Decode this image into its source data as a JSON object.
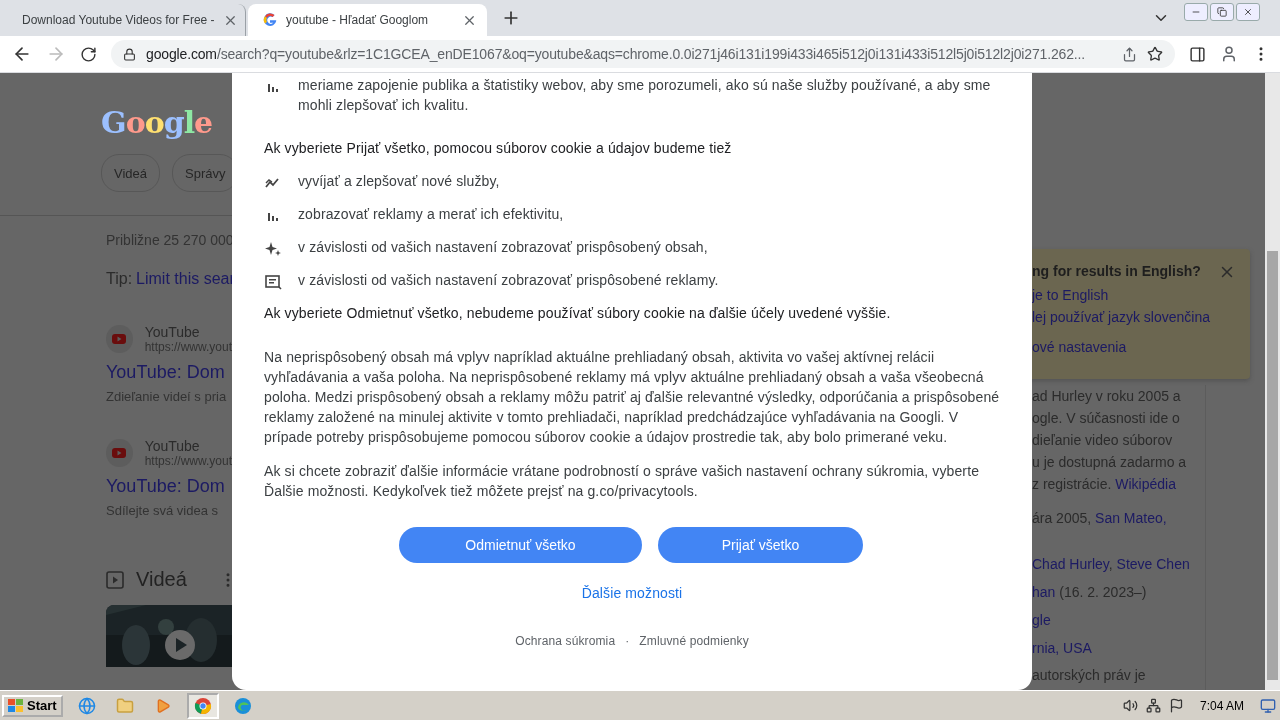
{
  "browser": {
    "tabs": [
      {
        "title": "Download Youtube Videos for Free -",
        "selected": false
      },
      {
        "title": "youtube - Hľadať Googlom",
        "selected": true
      }
    ],
    "address": {
      "host": "google.com",
      "path": "/search?q=youtube&rlz=1C1GCEA_enDE1067&oq=youtube&aqs=chrome.0.0i271j46i131i199i433i465i512j0i131i433i512l5j0i512l2j0i271.262..."
    }
  },
  "page_left": {
    "logo": "Google",
    "chips": [
      "Videá",
      "Správy"
    ],
    "result_count": "Približne 25 270 000",
    "tip_label": "Tip:",
    "tip_link": "Limit this sear",
    "results": [
      {
        "site": "YouTube",
        "url": "https://www.yout",
        "title": "YouTube: Dom",
        "snippet": "Zdieľanie videí s pria"
      },
      {
        "site": "YouTube",
        "url": "https://www.yout",
        "title": "YouTube: Dom",
        "snippet": "Sdílejte svá videa s"
      }
    ],
    "videos_heading": "Videá"
  },
  "page_right": {
    "language_prompt": {
      "title": "ng for results in English?",
      "links": [
        "je to English",
        "lej používať jazyk slovenčina",
        "ové nastavenia"
      ]
    },
    "knowledge_lines": [
      [
        {
          "text": "ad Hurley v roku 2005 a",
          "link": false
        }
      ],
      [
        {
          "text": "ogle. V súčasnosti ide o",
          "link": false
        }
      ],
      [
        {
          "text": "dieľanie video súborov",
          "link": false
        }
      ],
      [
        {
          "text": "u je dostupná zadarmo a",
          "link": false
        }
      ],
      [
        {
          "text": "z registrácie. ",
          "link": false
        },
        {
          "text": "Wikipédia",
          "link": true
        }
      ],
      [
        {
          "text": "ára 2005, ",
          "link": false
        },
        {
          "text": "San Mateo,",
          "link": true
        }
      ],
      [
        {
          "text": "Chad Hurley",
          "link": true
        },
        {
          "text": ", ",
          "link": false
        },
        {
          "text": "Steve Chen",
          "link": true
        }
      ],
      [
        {
          "text": "han",
          "link": true
        },
        {
          "text": " (16. 2. 2023–)",
          "link": false
        }
      ],
      [
        {
          "text": "gle",
          "link": true
        }
      ],
      [
        {
          "text": "rnia, USA",
          "link": true
        }
      ],
      [
        {
          "text": "autorských práv je",
          "link": false
        }
      ]
    ]
  },
  "dialog": {
    "top_items": [
      {
        "kind": "bars",
        "text": "meriame zapojenie publika a štatistiky webov, aby sme porozumeli, ako sú naše služby používané, a aby sme mohli zlepšovať ich kvalitu."
      }
    ],
    "accept_intro": "Ak vyberiete Prijať všetko, pomocou súborov cookie a údajov budeme tiež",
    "accept_items": [
      {
        "kind": "trend",
        "text": "vyvíjať a zlepšovať nové služby,"
      },
      {
        "kind": "bars",
        "text": "zobrazovať reklamy a merať ich efektivitu,"
      },
      {
        "kind": "sparkle",
        "text": "v závislosti od vašich nastavení zobrazovať prispôsobený obsah,"
      },
      {
        "kind": "ad",
        "text": "v závislosti od vašich nastavení zobrazovať prispôsobené reklamy."
      }
    ],
    "decline_text": "Ak vyberiete Odmietnuť všetko, nebudeme používať súbory cookie na ďalšie účely uvedené vyššie.",
    "paragraphs": [
      "Na neprispôsobený obsah má vplyv napríklad aktuálne prehliadaný obsah, aktivita vo vašej aktívnej relácii vyhľadávania a vaša poloha. Na neprispôsobené reklamy má vplyv aktuálne prehliadaný obsah a vaša všeobecná poloha. Medzi prispôsobený obsah a reklamy môžu patriť aj ďalšie relevantné výsledky, odporúčania a prispôsobené reklamy založené na minulej aktivite v tomto prehliadači, napríklad predchádzajúce vyhľadávania na Googli. V prípade potreby prispôsobujeme pomocou súborov cookie a údajov prostredie tak, aby bolo primerané veku.",
      "Ak si chcete zobraziť ďalšie informácie vrátane podrobností o správe vašich nastavení ochrany súkromia, vyberte Ďalšie možnosti. Kedykoľvek tiež môžete prejsť na g.co/privacytools."
    ],
    "buttons": [
      "Odmietnuť všetko",
      "Prijať všetko"
    ],
    "more_link": "Ďalšie možnosti",
    "footer_links": [
      "Ochrana súkromia",
      "Zmluvné podmienky"
    ],
    "footer_separator": "·"
  },
  "taskbar": {
    "start": "Start",
    "clock": "7:04 AM"
  }
}
